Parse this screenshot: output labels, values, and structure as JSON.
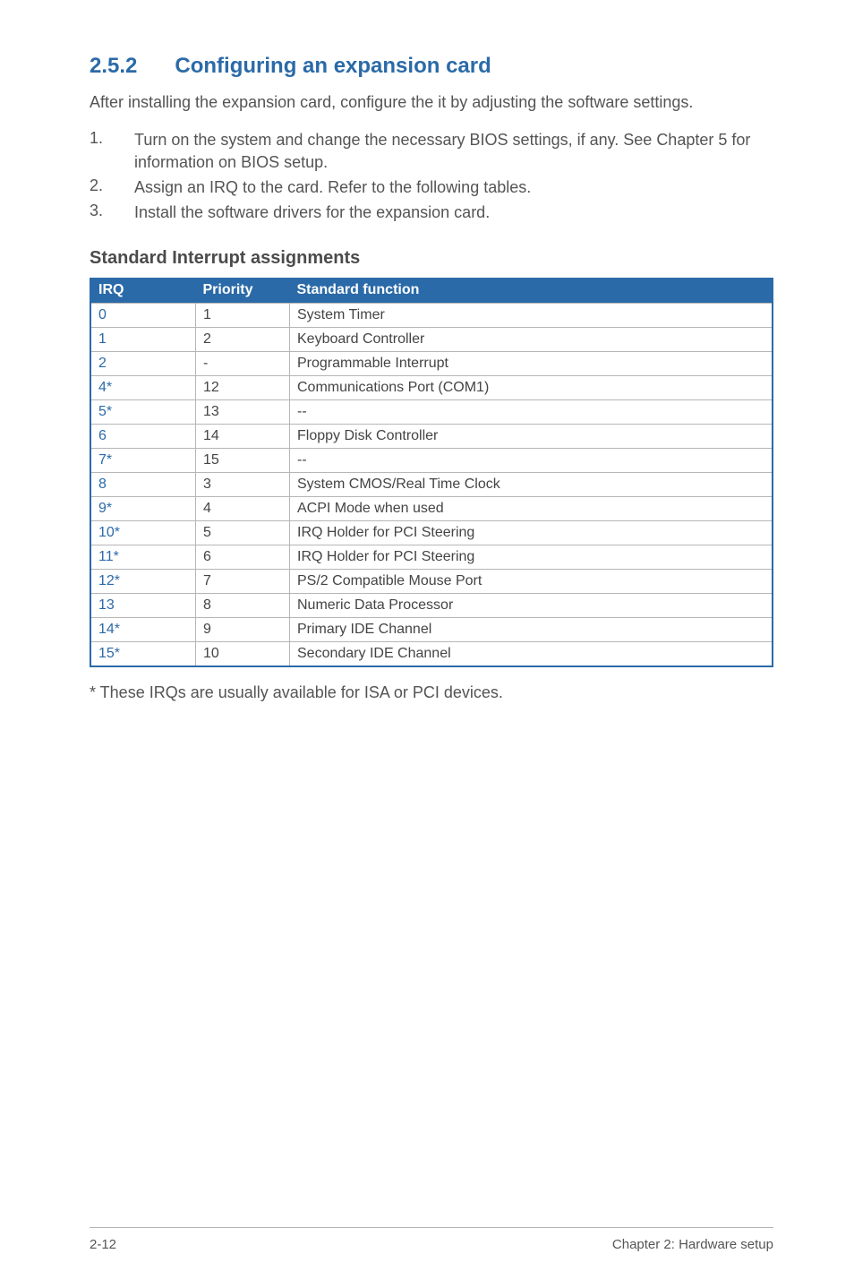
{
  "section": {
    "number": "2.5.2",
    "title": "Configuring an expansion card"
  },
  "intro": "After installing the expansion card, configure the it by adjusting the software settings.",
  "steps": [
    {
      "num": "1.",
      "text": "Turn on the system and change the necessary BIOS settings, if any. See Chapter 5 for information on BIOS setup."
    },
    {
      "num": "2.",
      "text": "Assign an IRQ to the card. Refer to the following tables."
    },
    {
      "num": "3.",
      "text": "Install the software drivers for the expansion card."
    }
  ],
  "subheading": "Standard Interrupt assignments",
  "table": {
    "headers": {
      "irq": "IRQ",
      "priority": "Priority",
      "func": "Standard function"
    },
    "rows": [
      {
        "irq": "0",
        "priority": "1",
        "func": "System Timer"
      },
      {
        "irq": "1",
        "priority": "2",
        "func": "Keyboard Controller"
      },
      {
        "irq": "2",
        "priority": "-",
        "func": "Programmable Interrupt"
      },
      {
        "irq": "4*",
        "priority": "12",
        "func": "Communications Port (COM1)"
      },
      {
        "irq": "5*",
        "priority": "13",
        "func": "--"
      },
      {
        "irq": "6",
        "priority": "14",
        "func": "Floppy Disk Controller"
      },
      {
        "irq": "7*",
        "priority": "15",
        "func": "--"
      },
      {
        "irq": "8",
        "priority": "3",
        "func": "System CMOS/Real Time Clock"
      },
      {
        "irq": "9*",
        "priority": "4",
        "func": "ACPI Mode when used"
      },
      {
        "irq": "10*",
        "priority": "5",
        "func": "IRQ Holder for PCI Steering"
      },
      {
        "irq": "11*",
        "priority": "6",
        "func": "IRQ Holder for PCI Steering"
      },
      {
        "irq": "12*",
        "priority": "7",
        "func": "PS/2 Compatible Mouse Port"
      },
      {
        "irq": "13",
        "priority": "8",
        "func": "Numeric Data Processor"
      },
      {
        "irq": "14*",
        "priority": "9",
        "func": "Primary IDE Channel"
      },
      {
        "irq": "15*",
        "priority": "10",
        "func": "Secondary IDE Channel"
      }
    ]
  },
  "footnote": "* These IRQs are usually available for ISA or PCI devices.",
  "footer": {
    "left": "2-12",
    "right": "Chapter 2:  Hardware setup"
  }
}
